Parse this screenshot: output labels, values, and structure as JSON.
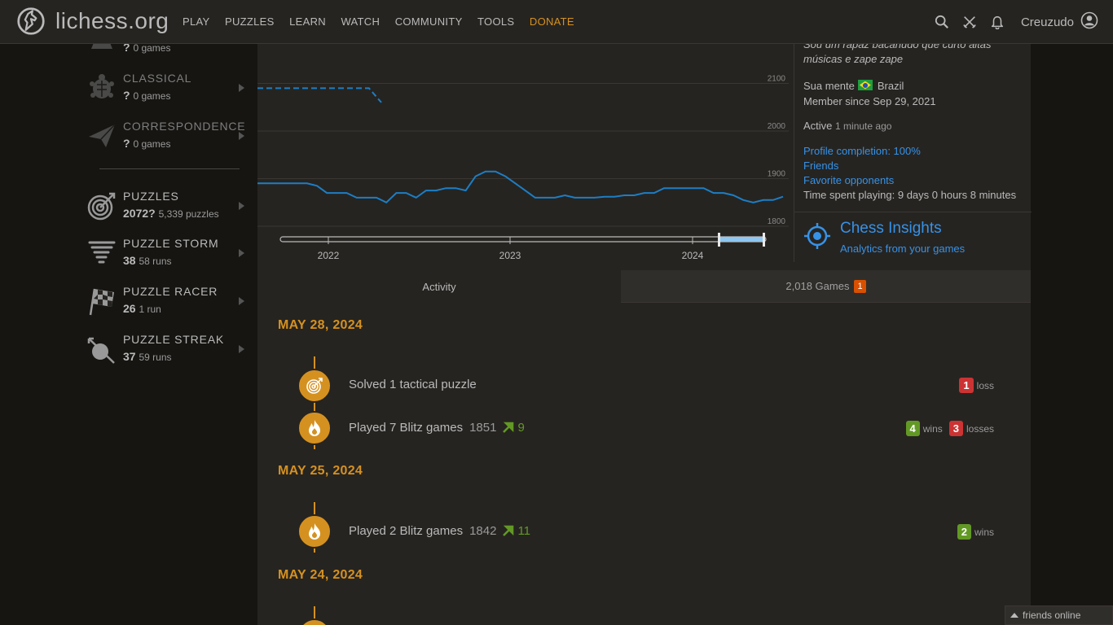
{
  "header": {
    "site": "lichess.org",
    "nav": [
      "PLAY",
      "PUZZLES",
      "LEARN",
      "WATCH",
      "COMMUNITY",
      "TOOLS",
      "DONATE"
    ],
    "username": "Creuzudo",
    "icons": [
      "search-icon",
      "swords-icon",
      "bell-icon",
      "user-circle-icon"
    ]
  },
  "sidebar": {
    "items": [
      {
        "name": "",
        "rating": "?",
        "count": "0 games",
        "icon": "rapid-icon"
      },
      {
        "name": "CLASSICAL",
        "rating": "?",
        "count": "0 games",
        "icon": "turtle-icon"
      },
      {
        "name": "CORRESPONDENCE",
        "rating": "?",
        "count": "0 games",
        "icon": "paper-plane-icon"
      },
      {
        "name": "PUZZLES",
        "rating": "2072?",
        "count": "5,339 puzzles",
        "icon": "target-icon"
      },
      {
        "name": "PUZZLE STORM",
        "rating": "38",
        "count": "58 runs",
        "icon": "tornado-icon"
      },
      {
        "name": "PUZZLE RACER",
        "rating": "26",
        "count": "1 run",
        "icon": "checkered-flag-icon"
      },
      {
        "name": "PUZZLE STREAK",
        "rating": "37",
        "count": "59 runs",
        "icon": "streak-icon"
      }
    ]
  },
  "chart_data": {
    "type": "line",
    "ylim": [
      1780,
      2140
    ],
    "y_ticks": [
      "2100",
      "2000",
      "1900",
      "1800"
    ],
    "x_ticks": [
      "2022",
      "2023",
      "2024"
    ],
    "series": [
      {
        "style": "dashed",
        "values": [
          2090,
          2090,
          2090,
          2090,
          2090,
          2090,
          2090,
          2090,
          2090,
          2090,
          2060
        ]
      },
      {
        "style": "solid",
        "values": [
          1890,
          1890,
          1890,
          1890,
          1890,
          1890,
          1885,
          1870,
          1870,
          1870,
          1860,
          1860,
          1860,
          1850,
          1870,
          1870,
          1860,
          1875,
          1875,
          1880,
          1880,
          1875,
          1905,
          1915,
          1915,
          1905,
          1890,
          1875,
          1860,
          1860,
          1860,
          1865,
          1860,
          1860,
          1860,
          1862,
          1862,
          1865,
          1865,
          1870,
          1870,
          1880,
          1880,
          1880,
          1880,
          1880,
          1870,
          1870,
          1865,
          1855,
          1850,
          1855,
          1855,
          1862
        ]
      }
    ]
  },
  "profile": {
    "bio": "Sou um rapaz bacanudo que curto altas músicas e zape zape",
    "name": "Sua mente",
    "country": "Brazil",
    "member_since": "Member since Sep 29, 2021",
    "active_label": "Active",
    "active_time": "1 minute ago",
    "completion": "Profile completion: 100%",
    "friends": "Friends",
    "favorite": "Favorite opponents",
    "time_spent": "Time spent playing: 9 days 0 hours 8 minutes"
  },
  "insights": {
    "title": "Chess Insights",
    "subtitle": "Analytics from your games"
  },
  "tabs": {
    "activity": "Activity",
    "games": "2,018 Games",
    "games_badge": "1"
  },
  "activity": {
    "days": [
      {
        "date": "MAY 28, 2024",
        "entries": [
          {
            "icon": "target-icon",
            "text": "Solved 1 tactical puzzle",
            "rating": "",
            "diff": "",
            "results": [
              {
                "n": "1",
                "label": "loss",
                "kind": "loss"
              }
            ]
          },
          {
            "icon": "fire-icon",
            "text": "Played 7 Blitz games",
            "rating": "1851",
            "diff": "9",
            "results": [
              {
                "n": "4",
                "label": "wins",
                "kind": "win"
              },
              {
                "n": "3",
                "label": "losses",
                "kind": "loss"
              }
            ]
          }
        ]
      },
      {
        "date": "MAY 25, 2024",
        "entries": [
          {
            "icon": "fire-icon",
            "text": "Played 2 Blitz games",
            "rating": "1842",
            "diff": "11",
            "results": [
              {
                "n": "2",
                "label": "wins",
                "kind": "win"
              }
            ]
          }
        ]
      },
      {
        "date": "MAY 24, 2024",
        "entries": []
      }
    ]
  },
  "friends_bar": "friends online",
  "colors": {
    "accent": "#d59120",
    "link": "#3692e7",
    "win": "#629924",
    "loss": "#cc3333",
    "chart_line": "#1c7ec5"
  }
}
